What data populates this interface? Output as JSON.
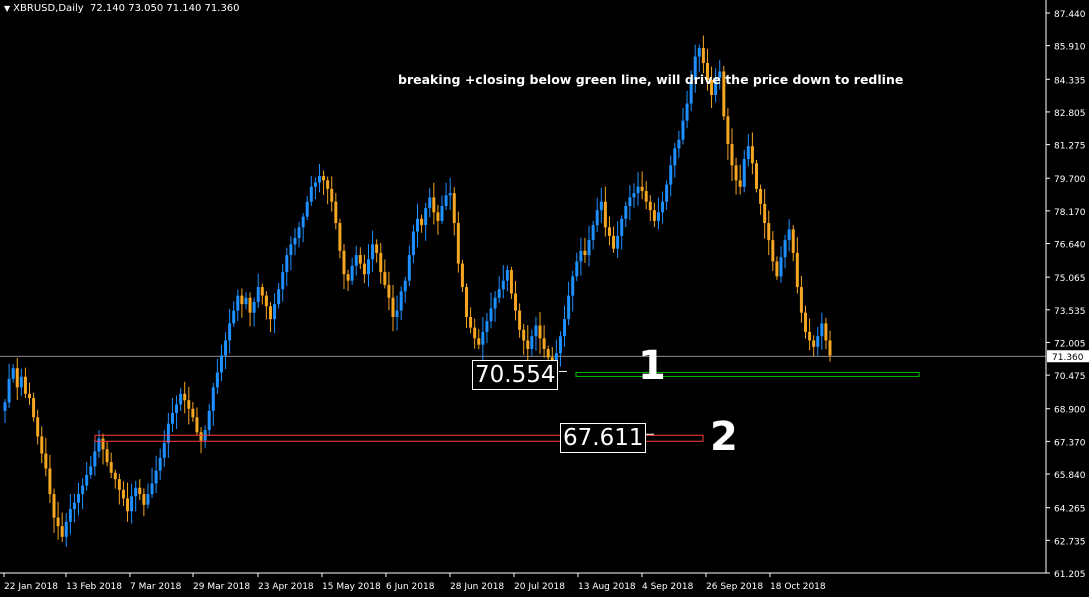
{
  "header": {
    "symbol": "XBRUSD,Daily",
    "ohlc": "72.140 73.050 71.140 71.360"
  },
  "annotation": "breaking +closing below green line, will drive the price down  to redline",
  "levels": [
    {
      "label": "70.554",
      "number": "1",
      "color": "#00c000"
    },
    {
      "label": "67.611",
      "number": "2",
      "color": "#ff3c3c"
    }
  ],
  "colors": {
    "background": "#000000",
    "bull": "#1e90ff",
    "bear": "#f5a623",
    "grid_text": "#ffffff",
    "current_price_line": "#c0c0c0"
  },
  "chart_data": {
    "type": "candlestick",
    "ylim": [
      61.205,
      87.44
    ],
    "y_ticks": [
      "87.440",
      "85.910",
      "84.335",
      "82.805",
      "81.275",
      "79.700",
      "78.170",
      "76.640",
      "75.065",
      "73.535",
      "72.005",
      "70.475",
      "68.900",
      "67.370",
      "65.840",
      "64.265",
      "62.735",
      "61.205"
    ],
    "x_ticks": [
      "22 Jan 2018",
      "13 Feb 2018",
      "7 Mar 2018",
      "29 Mar 2018",
      "23 Apr 2018",
      "15 May 2018",
      "6 Jun 2018",
      "28 Jun 2018",
      "20 Jul 2018",
      "13 Aug 2018",
      "4 Sep 2018",
      "26 Sep 2018",
      "18 Oct 2018"
    ],
    "current_price": "71.360",
    "close": [
      69.2,
      70.3,
      70.8,
      69.9,
      70.4,
      69.6,
      69.4,
      68.5,
      67.6,
      66.8,
      66.1,
      64.9,
      63.8,
      63.4,
      62.9,
      63.6,
      64.2,
      64.5,
      64.9,
      65.3,
      65.8,
      66.2,
      66.9,
      67.5,
      67.0,
      66.4,
      65.9,
      65.6,
      65.1,
      64.7,
      64.1,
      64.8,
      65.2,
      64.9,
      64.4,
      64.9,
      65.4,
      66.0,
      66.6,
      67.3,
      68.2,
      68.7,
      69.1,
      69.6,
      69.3,
      68.9,
      68.5,
      67.8,
      67.4,
      67.9,
      68.8,
      69.9,
      70.6,
      71.4,
      72.1,
      72.9,
      73.5,
      74.2,
      73.8,
      74.1,
      73.4,
      73.9,
      74.6,
      74.2,
      73.7,
      73.1,
      73.8,
      74.5,
      75.3,
      76.1,
      76.6,
      76.9,
      77.4,
      77.9,
      78.6,
      79.3,
      79.5,
      79.8,
      79.6,
      79.2,
      78.6,
      77.6,
      76.3,
      75.2,
      74.9,
      75.6,
      76.1,
      75.7,
      75.2,
      75.9,
      76.6,
      76.2,
      75.3,
      74.7,
      74.1,
      73.2,
      73.5,
      74.4,
      74.9,
      76.1,
      77.2,
      77.8,
      77.5,
      78.3,
      78.8,
      78.1,
      77.7,
      78.4,
      78.9,
      79.0,
      77.6,
      75.7,
      74.6,
      73.2,
      72.7,
      72.2,
      71.9,
      72.5,
      73.0,
      73.6,
      74.1,
      74.5,
      74.9,
      75.4,
      74.3,
      73.5,
      72.6,
      72.1,
      71.7,
      72.3,
      72.8,
      72.2,
      71.7,
      71.3,
      71.0,
      71.5,
      72.3,
      73.1,
      74.2,
      75.1,
      75.8,
      76.3,
      76.1,
      76.8,
      77.5,
      78.2,
      78.6,
      77.4,
      77.0,
      76.4,
      77.0,
      77.8,
      78.4,
      78.8,
      79.0,
      79.3,
      79.1,
      78.6,
      78.2,
      77.7,
      78.1,
      78.6,
      79.4,
      80.3,
      81.1,
      81.5,
      82.4,
      83.2,
      84.3,
      85.4,
      85.8,
      85.1,
      84.3,
      83.6,
      84.4,
      84.7,
      82.6,
      81.3,
      80.3,
      79.6,
      79.3,
      80.6,
      81.2,
      80.4,
      79.2,
      78.5,
      77.6,
      76.8,
      75.8,
      75.1,
      76.0,
      76.8,
      77.3,
      76.2,
      74.6,
      73.4,
      72.5,
      72.1,
      71.8,
      72.3,
      72.9,
      72.1,
      71.4
    ]
  }
}
